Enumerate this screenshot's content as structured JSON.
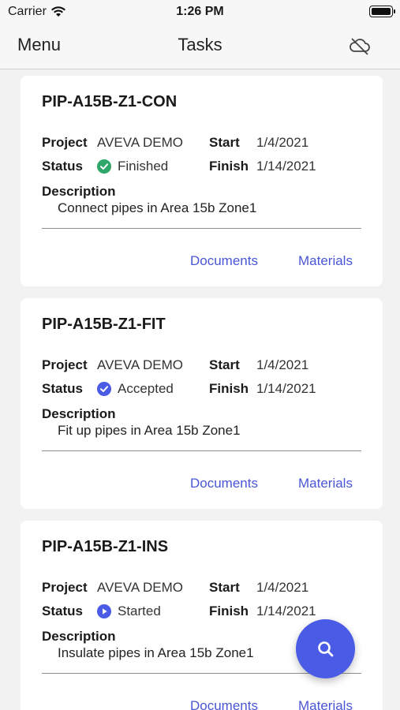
{
  "status_bar": {
    "carrier": "Carrier",
    "time": "1:26 PM"
  },
  "nav": {
    "menu": "Menu",
    "title": "Tasks",
    "offline_icon": "cloud-offline-icon"
  },
  "labels": {
    "project": "Project",
    "start": "Start",
    "status": "Status",
    "finish": "Finish",
    "description": "Description",
    "documents": "Documents",
    "materials": "Materials"
  },
  "colors": {
    "finished": "#2fa66a",
    "accepted": "#4a5be6",
    "started": "#4a5be6",
    "link": "#4a56d6",
    "fab": "#4a5be6"
  },
  "tasks": [
    {
      "title": "PIP-A15B-Z1-CON",
      "project": "AVEVA DEMO",
      "start": "1/4/2021",
      "status": "Finished",
      "status_icon": "check-circle-icon",
      "finish": "1/14/2021",
      "description": "Connect pipes in Area 15b Zone1"
    },
    {
      "title": "PIP-A15B-Z1-FIT",
      "project": "AVEVA DEMO",
      "start": "1/4/2021",
      "status": "Accepted",
      "status_icon": "check-circle-icon",
      "finish": "1/14/2021",
      "description": "Fit up pipes in Area 15b Zone1"
    },
    {
      "title": "PIP-A15B-Z1-INS",
      "project": "AVEVA DEMO",
      "start": "1/4/2021",
      "status": "Started",
      "status_icon": "play-circle-icon",
      "finish": "1/14/2021",
      "description": "Insulate pipes in Area 15b Zone1"
    }
  ],
  "fab": {
    "icon": "search-icon"
  }
}
